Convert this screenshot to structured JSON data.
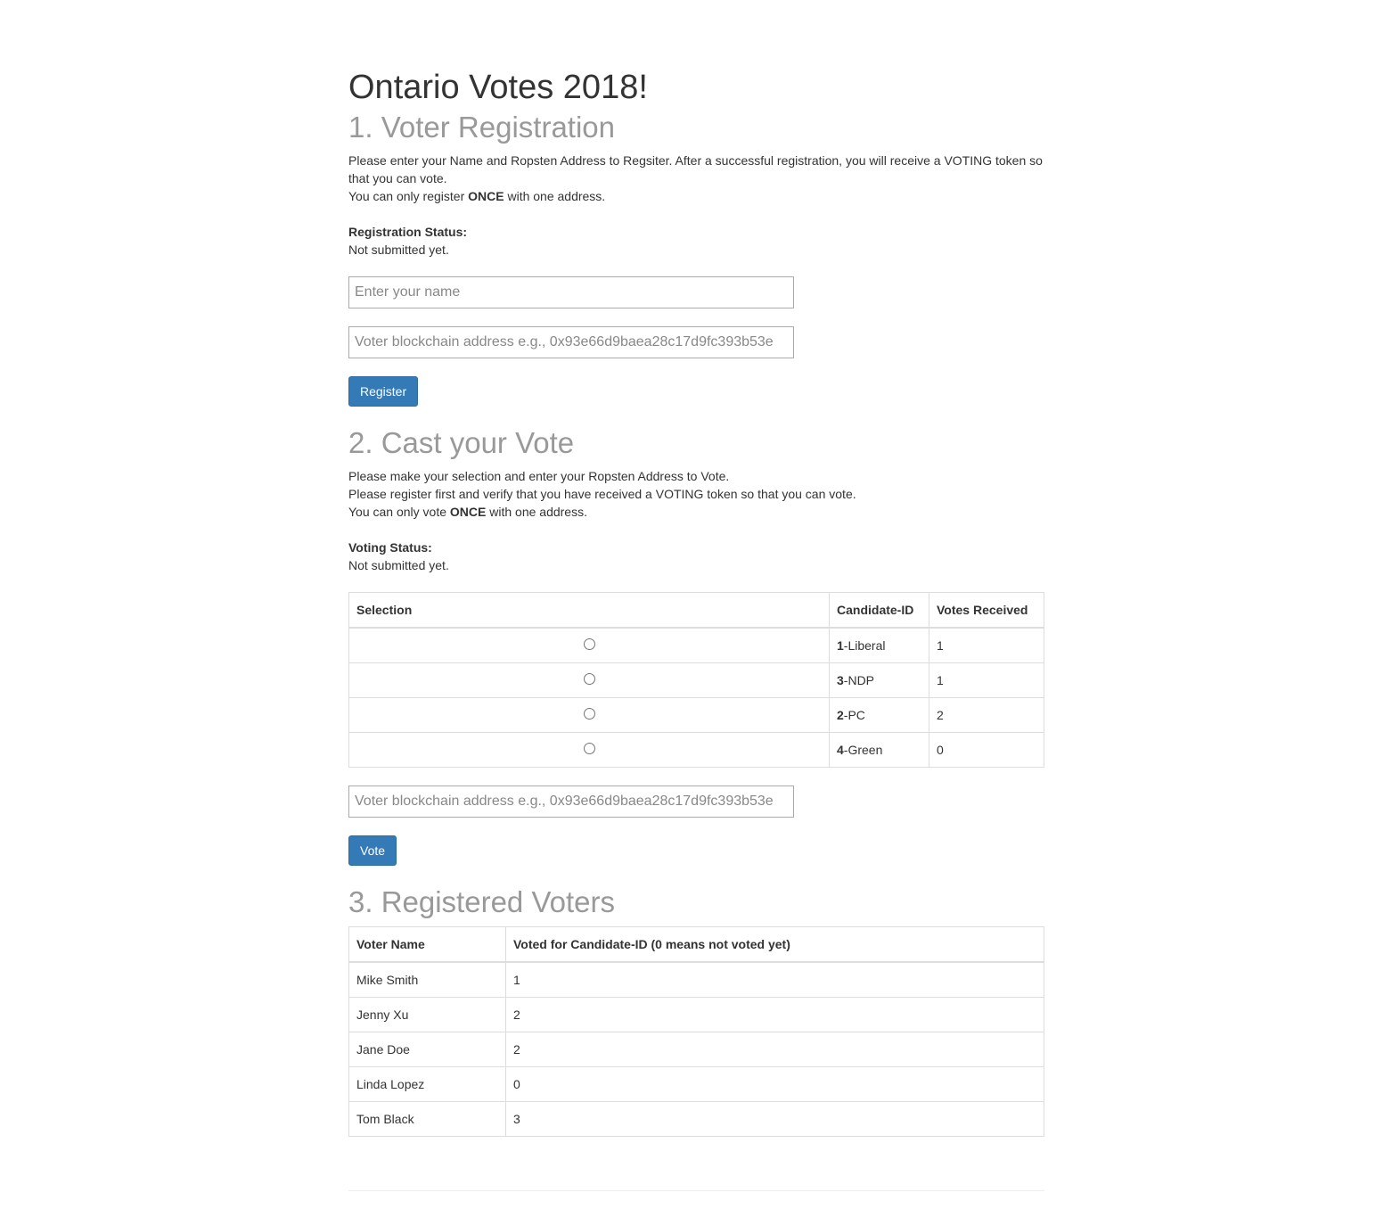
{
  "title": "Ontario Votes 2018!",
  "registration": {
    "heading": "1. Voter Registration",
    "desc1": "Please enter your Name and Ropsten Address to Regsiter. After a successful registration, you will receive a VOTING token so that you can vote.",
    "desc2_pre": "You can only register ",
    "desc2_bold": "ONCE",
    "desc2_post": " with one address.",
    "status_label": "Registration Status:",
    "status_value": "Not submitted yet.",
    "name_placeholder": "Enter your name",
    "address_placeholder": "Voter blockchain address e.g., 0x93e66d9baea28c17d9fc393b53e",
    "button": "Register"
  },
  "vote": {
    "heading": "2. Cast your Vote",
    "desc1": "Please make your selection and enter your Ropsten Address to Vote.",
    "desc2": "Please register first and verify that you have received a VOTING token so that you can vote.",
    "desc3_pre": "You can only vote ",
    "desc3_bold": "ONCE",
    "desc3_post": " with one address.",
    "status_label": "Voting Status:",
    "status_value": "Not submitted yet.",
    "columns": [
      "Selection",
      "Candidate-ID",
      "Votes Received"
    ],
    "candidates": [
      {
        "id": "1",
        "name": "-Liberal",
        "votes": "1"
      },
      {
        "id": "3",
        "name": "-NDP",
        "votes": "1"
      },
      {
        "id": "2",
        "name": "-PC",
        "votes": "2"
      },
      {
        "id": "4",
        "name": "-Green",
        "votes": "0"
      }
    ],
    "address_placeholder": "Voter blockchain address e.g., 0x93e66d9baea28c17d9fc393b53e",
    "button": "Vote"
  },
  "voters": {
    "heading": "3. Registered Voters",
    "columns": [
      "Voter Name",
      "Voted for Candidate-ID (0 means not voted yet)"
    ],
    "rows": [
      {
        "name": "Mike Smith",
        "vote": "1"
      },
      {
        "name": "Jenny Xu",
        "vote": "2"
      },
      {
        "name": "Jane Doe",
        "vote": "2"
      },
      {
        "name": "Linda Lopez",
        "vote": "0"
      },
      {
        "name": "Tom Black",
        "vote": "3"
      }
    ]
  }
}
